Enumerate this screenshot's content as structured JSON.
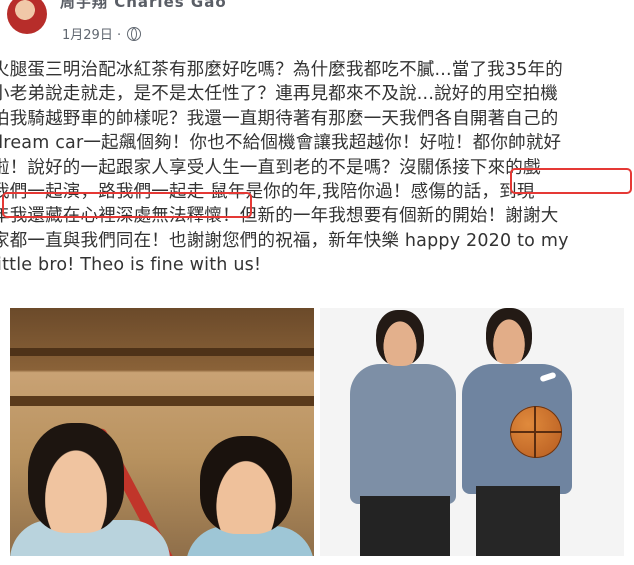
{
  "post": {
    "author": "周宇翔 Charles Gao",
    "date": "1月29日 ·",
    "lines": [
      "火腿蛋三明治配冰紅茶有那麼好吃嗎？為什麼我都吃不膩...當了我35年的",
      "小老弟說走就走，是不是太任性了？連再見都來不及說...說好的用空拍機",
      "拍我騎越野車的帥樣呢？我還一直期待著有那麼一天我們各自開著自己的",
      "dream car一起飆個夠！你也不給個機會讓我超越你！好啦！都你帥就好",
      "啦！說好的一起跟家人享受人生一直到老的不是嗎？沒關係",
      "我們一起演，路我們一起走",
      "年我還藏在心裡深處無法釋懷！但新的一年我想要有個新的開始！謝謝大",
      "家都一直與我們同在！也謝謝您們的祝福，新年快樂 happy 2020 to my",
      "little bro! Theo is fine with us!"
    ],
    "highlight_1": "接下來的戲",
    "line6_rest": " 鼠年是你的年,我陪你過！感傷的話，到現"
  },
  "icons": {
    "privacy": "globe-icon"
  },
  "colors": {
    "highlight": "#e53935"
  }
}
